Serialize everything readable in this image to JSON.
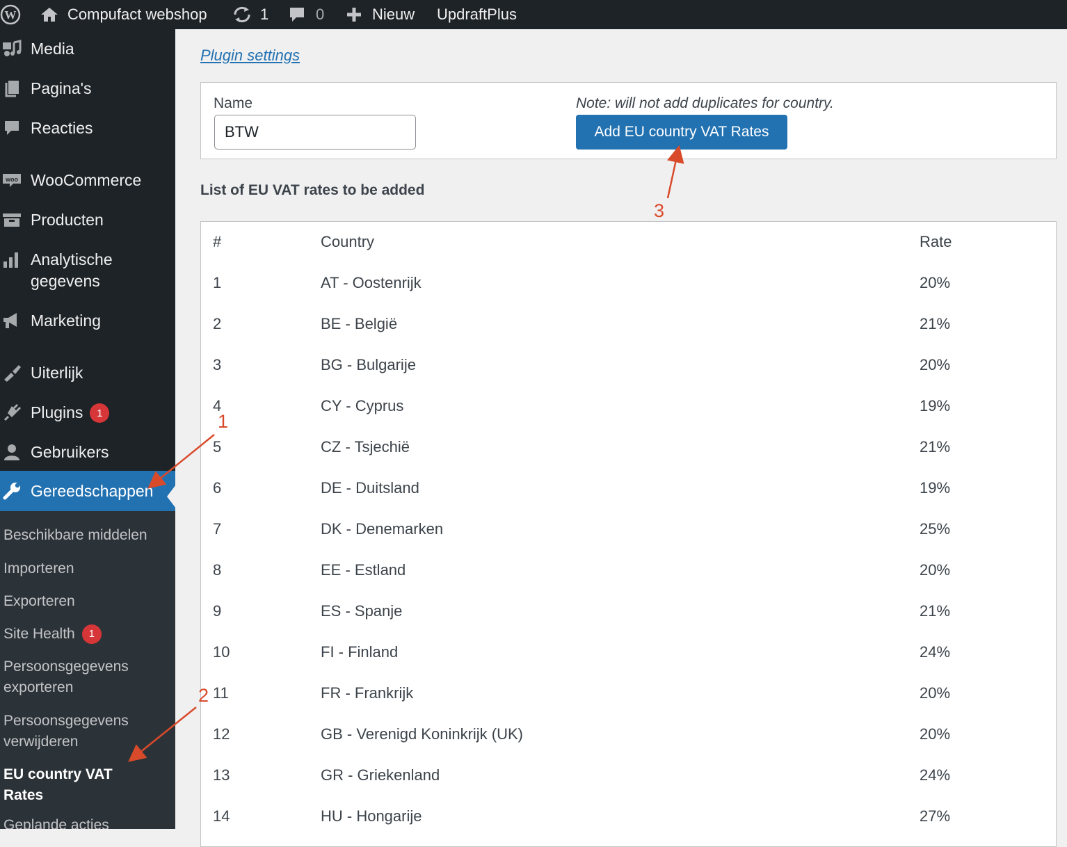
{
  "adminbar": {
    "site_name": "Compufact webshop",
    "updates_count": "1",
    "comments_count": "0",
    "new_label": "Nieuw",
    "plugin_label": "UpdraftPlus"
  },
  "sidebar": {
    "items": [
      {
        "label": "Media",
        "icon": "media-icon"
      },
      {
        "label": "Pagina's",
        "icon": "pages-icon"
      },
      {
        "label": "Reacties",
        "icon": "comments-icon"
      },
      {
        "label": "WooCommerce",
        "icon": "woocommerce-icon"
      },
      {
        "label": "Producten",
        "icon": "products-icon"
      },
      {
        "label": "Analytische gegevens",
        "icon": "analytics-icon"
      },
      {
        "label": "Marketing",
        "icon": "megaphone-icon"
      },
      {
        "label": "Uiterlijk",
        "icon": "appearance-icon"
      },
      {
        "label": "Plugins",
        "icon": "plugins-icon",
        "badge": "1"
      },
      {
        "label": "Gebruikers",
        "icon": "users-icon"
      },
      {
        "label": "Gereedschappen",
        "icon": "wrench-icon"
      }
    ],
    "submenu": [
      {
        "label": "Beschikbare middelen"
      },
      {
        "label": "Importeren"
      },
      {
        "label": "Exporteren"
      },
      {
        "label": "Site Health",
        "badge": "1"
      },
      {
        "label": "Persoonsgegevens exporteren"
      },
      {
        "label": "Persoonsgegevens verwijderen"
      },
      {
        "label": "EU country VAT Rates"
      },
      {
        "label": "Geplande acties"
      }
    ]
  },
  "main": {
    "plugin_settings_link": "Plugin settings",
    "name_label": "Name",
    "name_value": "BTW",
    "note": "Note: will not add duplicates for country.",
    "add_button": "Add EU country VAT Rates",
    "list_heading": "List of EU VAT rates to be added",
    "table": {
      "headers": [
        "#",
        "Country",
        "Rate"
      ],
      "rows": [
        [
          "1",
          "AT - Oostenrijk",
          "20%"
        ],
        [
          "2",
          "BE - België",
          "21%"
        ],
        [
          "3",
          "BG - Bulgarije",
          "20%"
        ],
        [
          "4",
          "CY - Cyprus",
          "19%"
        ],
        [
          "5",
          "CZ - Tsjechië",
          "21%"
        ],
        [
          "6",
          "DE - Duitsland",
          "19%"
        ],
        [
          "7",
          "DK - Denemarken",
          "25%"
        ],
        [
          "8",
          "EE - Estland",
          "20%"
        ],
        [
          "9",
          "ES - Spanje",
          "21%"
        ],
        [
          "10",
          "FI - Finland",
          "24%"
        ],
        [
          "11",
          "FR - Frankrijk",
          "20%"
        ],
        [
          "12",
          "GB - Verenigd Koninkrijk (UK)",
          "20%"
        ],
        [
          "13",
          "GR - Griekenland",
          "24%"
        ],
        [
          "14",
          "HU - Hongarije",
          "27%"
        ]
      ]
    }
  },
  "annotations": {
    "step1": "1",
    "step2": "2",
    "step3": "3",
    "color": "#d94a2b"
  },
  "colors": {
    "adminbar": "#1d2327",
    "accent": "#2271b1",
    "badge": "#d63638",
    "background": "#f0f0f1"
  }
}
